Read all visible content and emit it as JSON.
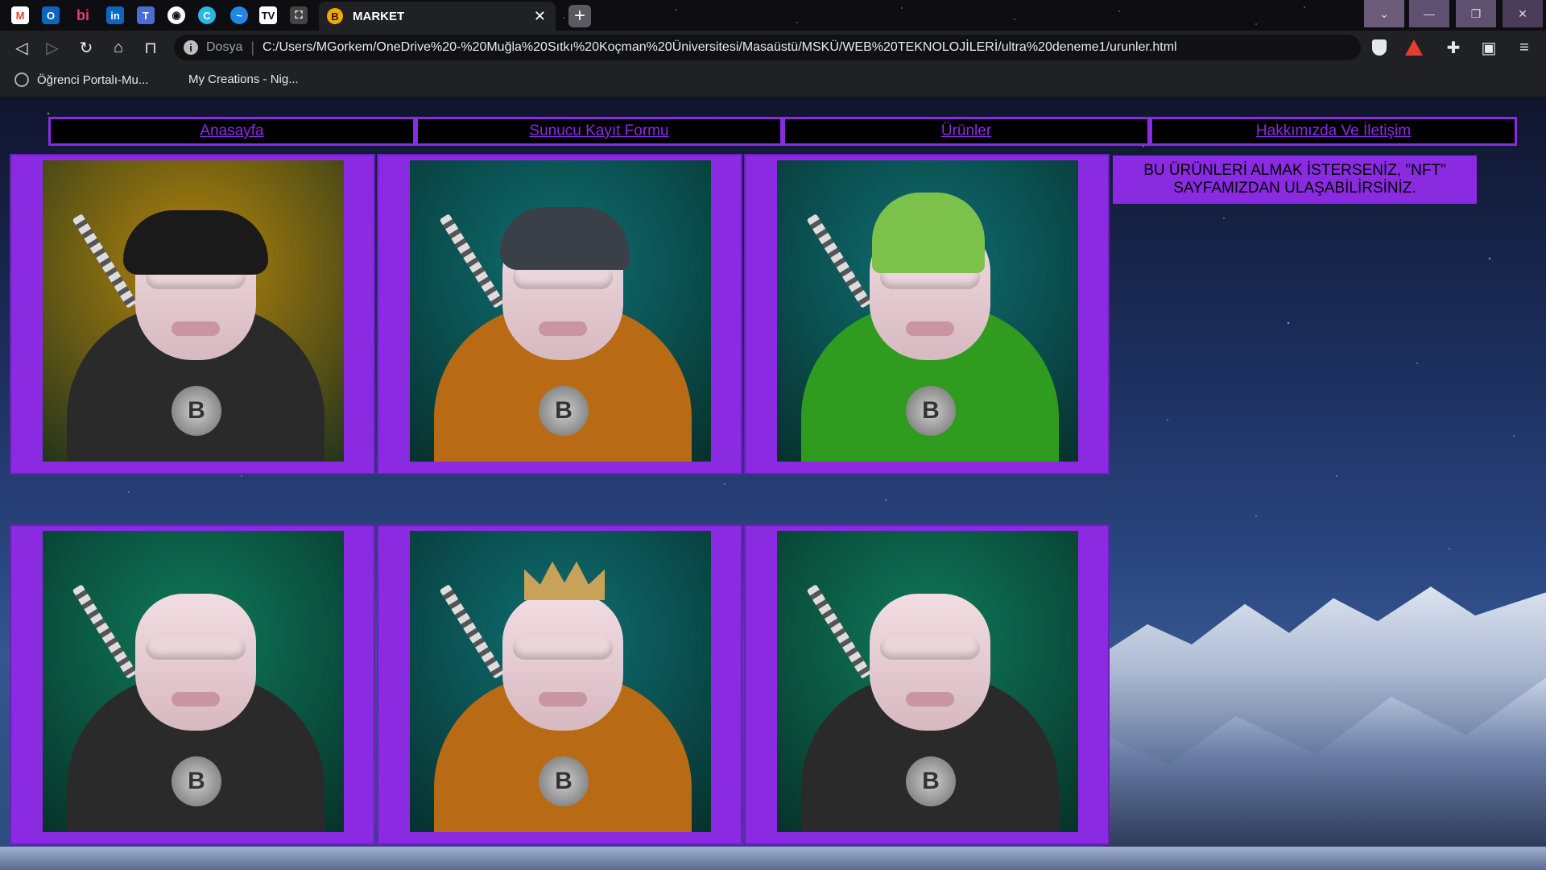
{
  "browser": {
    "tab": {
      "title": "MARKET",
      "favicon": "bitcoin-icon"
    },
    "pinned_tabs": [
      "gmail-icon",
      "outlook-icon",
      "bi-icon",
      "linkedin-icon",
      "teams-icon",
      "github-icon",
      "canva-icon",
      "messenger-icon",
      "tradingview-icon",
      "screenshot-icon"
    ],
    "address": {
      "scheme_label": "Dosya",
      "url": "C:/Users/MGorkem/OneDrive%20-%20Muğla%20Sıtkı%20Koçman%20Üniversitesi/Masaüstü/MSKÜ/WEB%20TEKNOLOJİLERİ/ultra%20deneme1/urunler.html"
    },
    "bookmarks": [
      "Öğrenci Portalı-Mu...",
      "My Creations - Nig..."
    ]
  },
  "nav": {
    "items": [
      "Anasayfa",
      "Sunucu Kayıt Formu",
      "Ürünler",
      "Hakkımızda Ve İletişim"
    ],
    "color": "#8a2be2"
  },
  "info": {
    "text_line1": "BU ÜRÜNLERİ ALMAK İSTERSENİZ, \"NFT\"",
    "text_line2": "SAYFAMIZDAN ULAŞABİLİRSİNİZ."
  },
  "products": [
    {
      "bg": "#b7860b",
      "outfit": "#2a2a2a",
      "hat": "bucket",
      "hat_color": "#1a1a1a"
    },
    {
      "bg": "#0f6f73",
      "outfit": "#b86b14",
      "hat": "cap",
      "hat_color": "#3a4048"
    },
    {
      "bg": "#0f6f73",
      "outfit": "#2f9c1f",
      "hat": "beanie",
      "hat_color": "#7cc24a"
    },
    {
      "bg": "#0f7a5a",
      "outfit": "#2a2a2a",
      "hat": "none",
      "hat_color": "#c9a25a"
    },
    {
      "bg": "#0f6f73",
      "outfit": "#b86b14",
      "hat": "crown",
      "hat_color": "#c9a25a"
    },
    {
      "bg": "#0f7a5a",
      "outfit": "#2a2a2a",
      "hat": "none",
      "hat_color": "#7b3f2a"
    }
  ]
}
